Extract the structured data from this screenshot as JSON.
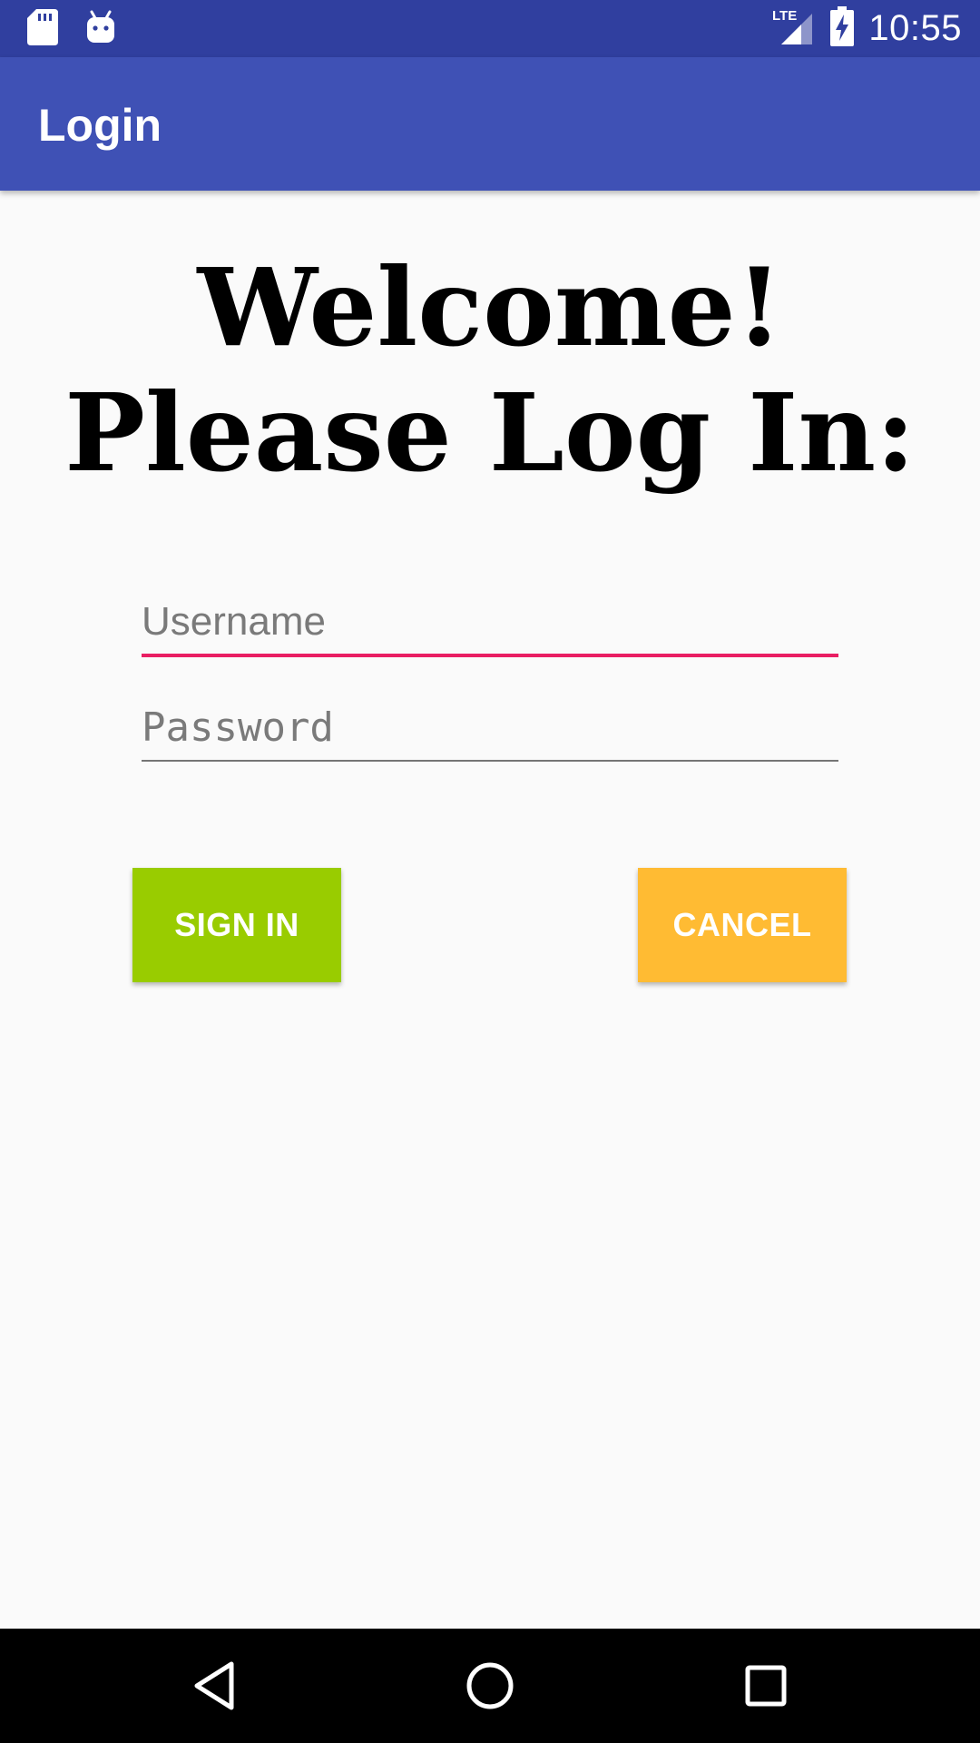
{
  "status_bar": {
    "time": "10:55",
    "network_label": "LTE",
    "icons": [
      "sd-card-icon",
      "android-debug-icon",
      "lte-signal-icon",
      "battery-charging-icon"
    ]
  },
  "app_bar": {
    "title": "Login"
  },
  "welcome": {
    "line1": "Welcome!",
    "line2": "Please Log In:"
  },
  "form": {
    "username": {
      "value": "",
      "placeholder": "Username"
    },
    "password": {
      "value": "",
      "placeholder": "Password"
    }
  },
  "buttons": {
    "sign_in": "SIGN IN",
    "cancel": "CANCEL"
  },
  "nav_bar": {
    "icons": [
      "back-icon",
      "home-icon",
      "recents-icon"
    ]
  },
  "colors": {
    "status_bar": "#303f9f",
    "app_bar": "#3f51b5",
    "username_underline": "#e91e63",
    "sign_in": "#99cc00",
    "cancel": "#ffbb33"
  }
}
